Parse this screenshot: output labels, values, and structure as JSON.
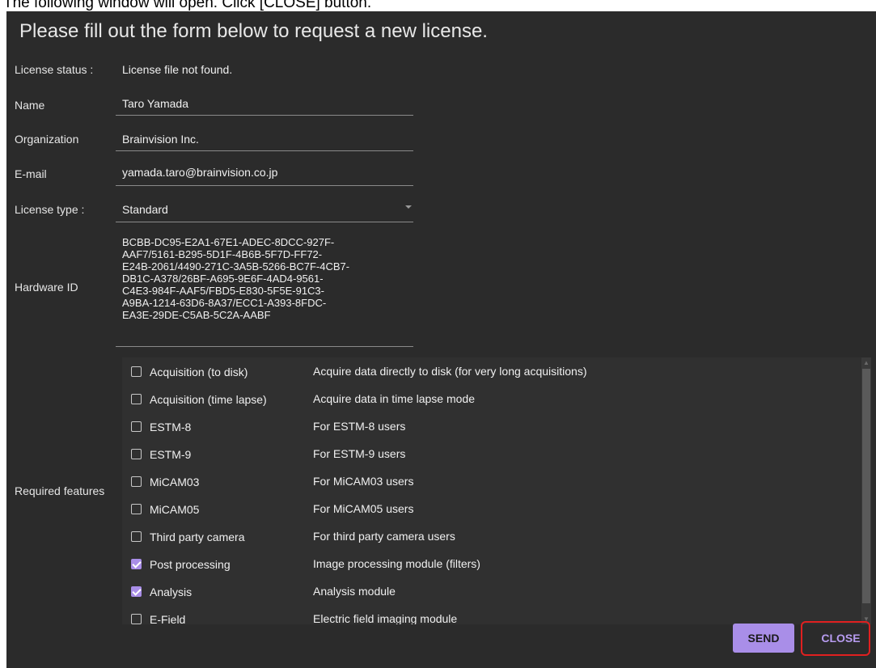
{
  "instruction": "The following window will open. Click [CLOSE] button.",
  "dialog": {
    "title": "Please fill out the form below to request a new license.",
    "license_status": {
      "label": "License status :",
      "value": "License file not found."
    },
    "name": {
      "label": "Name",
      "value": "Taro Yamada"
    },
    "organization": {
      "label": "Organization",
      "value": "Brainvision Inc."
    },
    "email": {
      "label": "E-mail",
      "value": "yamada.taro@brainvision.co.jp"
    },
    "license_type": {
      "label": "License type :",
      "value": "Standard"
    },
    "hardware_id": {
      "label": "Hardware ID",
      "lines": [
        "BCBB-DC95-E2A1-67E1-ADEC-8DCC-927F-",
        "AAF7/5161-B295-5D1F-4B6B-5F7D-FF72-",
        "E24B-2061/4490-271C-3A5B-5266-BC7F-4CB7-",
        "DB1C-A378/26BF-A695-9E6F-4AD4-9561-",
        "C4E3-984F-AAF5/FBD5-E830-5F5E-91C3-",
        "A9BA-1214-63D6-8A37/ECC1-A393-8FDC-",
        "EA3E-29DE-C5AB-5C2A-AABF"
      ]
    },
    "required_features": {
      "label": "Required features",
      "items": [
        {
          "name": "Acquisition (to disk)",
          "description": "Acquire data directly to disk (for very long acquisitions)",
          "checked": false
        },
        {
          "name": "Acquisition (time lapse)",
          "description": "Acquire data in time lapse mode",
          "checked": false
        },
        {
          "name": "ESTM-8",
          "description": "For ESTM-8 users",
          "checked": false
        },
        {
          "name": "ESTM-9",
          "description": "For ESTM-9 users",
          "checked": false
        },
        {
          "name": "MiCAM03",
          "description": "For MiCAM03 users",
          "checked": false
        },
        {
          "name": "MiCAM05",
          "description": "For MiCAM05 users",
          "checked": false
        },
        {
          "name": "Third party camera",
          "description": "For third party camera users",
          "checked": false
        },
        {
          "name": "Post processing",
          "description": "Image processing module (filters)",
          "checked": true
        },
        {
          "name": "Analysis",
          "description": "Analysis module",
          "checked": true
        },
        {
          "name": "E-Field",
          "description": "Electric field imaging module",
          "checked": false
        }
      ]
    },
    "buttons": {
      "send": "SEND",
      "close": "CLOSE"
    }
  },
  "colors": {
    "dialog_bg": "#2b2b2b",
    "accent": "#a98ee8",
    "highlight": "#e02020"
  }
}
